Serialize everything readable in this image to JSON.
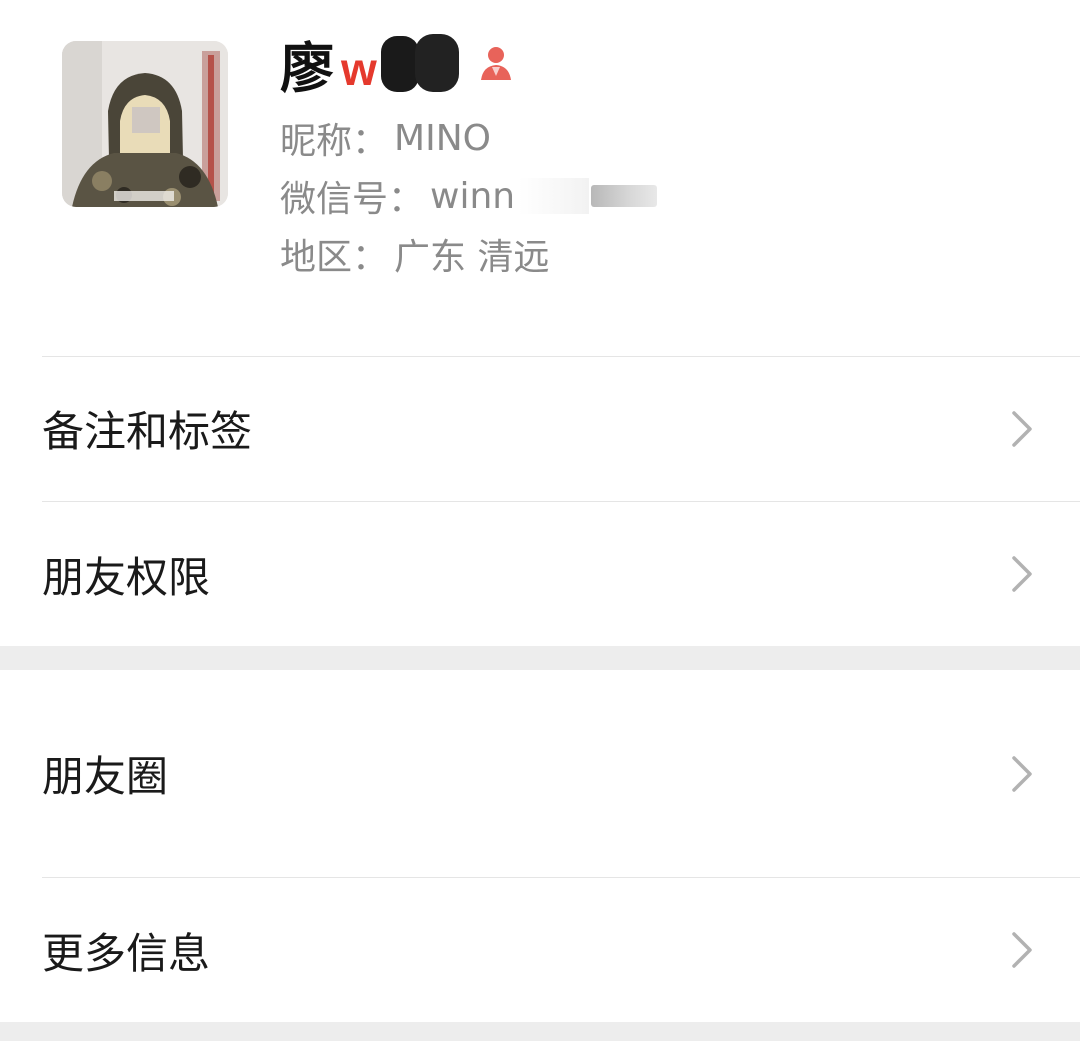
{
  "profile": {
    "name": "廖",
    "name_mask_text": "w",
    "nickname_label": "昵称：",
    "nickname_value": "MINO",
    "wechat_id_label": "微信号：",
    "wechat_id_value": "winn",
    "region_label": "地区：",
    "region_value": "广东 清远",
    "gender_icon": "female-person-icon",
    "gender_icon_color": "#e8635a"
  },
  "groups": [
    {
      "items": [
        {
          "label": "备注和标签",
          "icon": "chevron-right-icon"
        },
        {
          "label": "朋友权限",
          "icon": "chevron-right-icon"
        }
      ]
    },
    {
      "items": [
        {
          "label": "朋友圈",
          "icon": "chevron-right-icon"
        },
        {
          "label": "更多信息",
          "icon": "chevron-right-icon"
        }
      ]
    }
  ],
  "colors": {
    "background": "#ededed",
    "cell": "#ffffff",
    "secondary_text": "#8a8a8a",
    "chevron": "#b2b2b2"
  }
}
